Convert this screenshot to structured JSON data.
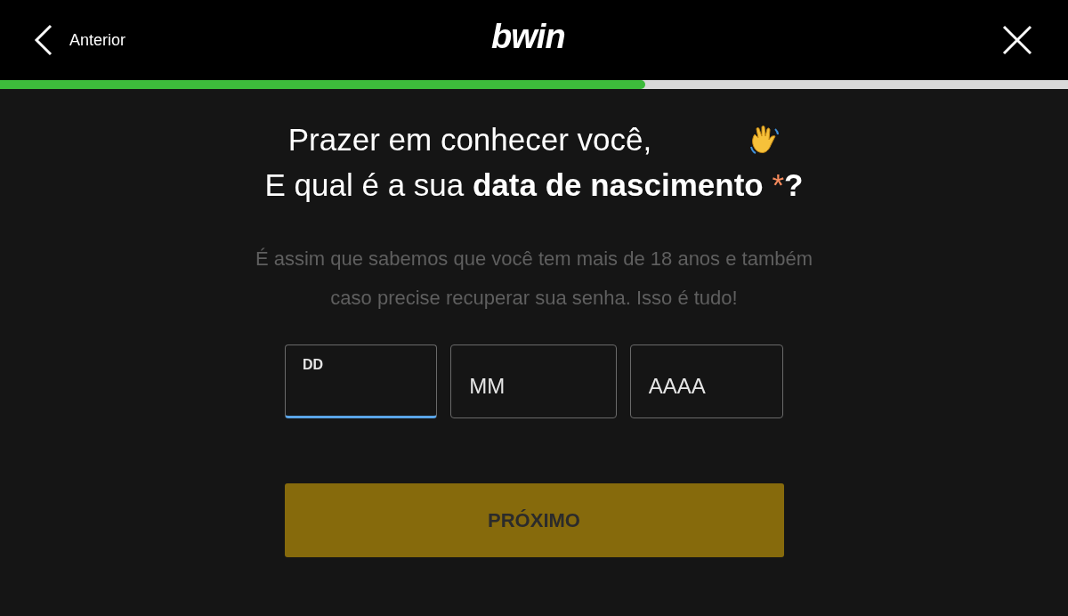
{
  "header": {
    "back_label": "Anterior",
    "logo": "bwin"
  },
  "progress": {
    "level": 0.604
  },
  "heading": {
    "greeting": "Prazer em conhecer você,",
    "question": "E qual é a sua **data de nascimento** ",
    "required_mark": "*",
    "question_end": "**?**"
  },
  "description": "É assim que sabemos que você tem mais de 18 anos e também caso precise recuperar sua senha. Isso é tudo!",
  "fields": [
    {
      "label": "DD",
      "focused": true
    },
    {
      "label": "MM",
      "focused": false
    },
    {
      "label": "AAAA",
      "focused": false
    }
  ],
  "next_button": {
    "label": "PRÓXIMO",
    "disabled": true
  }
}
